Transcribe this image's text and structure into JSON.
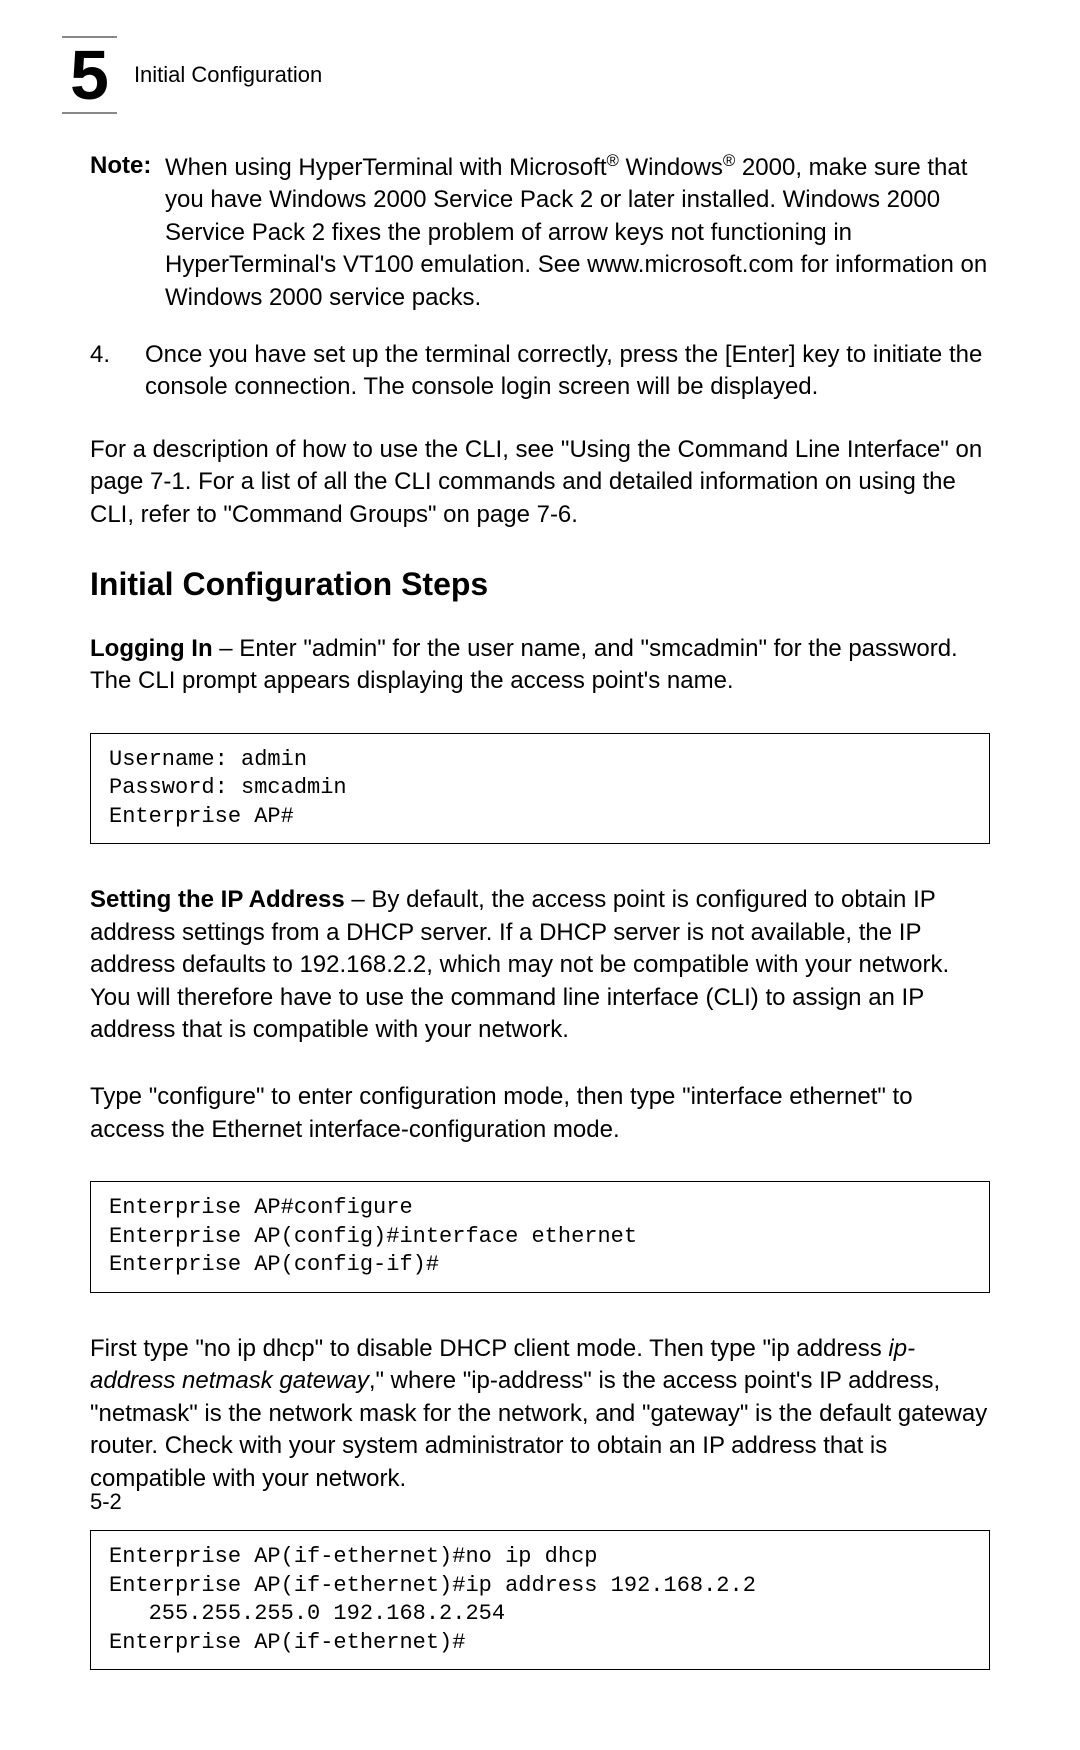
{
  "header": {
    "chapter_number": "5",
    "title": "Initial Configuration"
  },
  "note": {
    "label": "Note:",
    "text_before_reg1": "When using HyperTerminal with Microsoft",
    "reg1": "®",
    "text_mid": " Windows",
    "reg2": "®",
    "text_after": " 2000, make sure that you have Windows 2000 Service Pack 2 or later installed. Windows 2000 Service Pack 2 fixes the problem of arrow keys not functioning in HyperTerminal's VT100 emulation. See www.microsoft.com for information on Windows 2000 service packs."
  },
  "step4": {
    "num": "4.",
    "text": "Once you have set up the terminal correctly, press the [Enter] key to initiate the console connection. The console login screen will be displayed."
  },
  "cli_ref": "For a description of how to use the CLI, see \"Using the Command Line Interface\" on page 7-1. For a list of all the CLI commands and detailed information on using the CLI, refer to \"Command Groups\" on page 7-6.",
  "section_title": "Initial Configuration Steps",
  "logging_in": {
    "lead": "Logging In",
    "text": " – Enter \"admin\" for the user name, and \"smcadmin\" for the password. The CLI prompt appears displaying the access point's name."
  },
  "code1": "Username: admin\nPassword: smcadmin\nEnterprise AP#",
  "setting_ip": {
    "lead": "Setting the IP Address",
    "text": " – By default, the access point is configured to obtain IP address settings from a DHCP server. If a DHCP server is not available, the IP address defaults to 192.168.2.2, which may not be compatible with your network. You will therefore have to use the command line interface (CLI) to assign an IP address that is compatible with your network."
  },
  "type_configure": "Type \"configure\" to enter configuration mode, then type \"interface ethernet\" to access the Ethernet interface-configuration mode.",
  "code2": "Enterprise AP#configure\nEnterprise AP(config)#interface ethernet\nEnterprise AP(config-if)#",
  "first_type": {
    "part1": "First type \"no ip dhcp\" to disable DHCP client mode. Then type \"ip address ",
    "italic": "ip-address netmask gateway",
    "part2": ",\" where \"ip-address\" is the access point's IP address, \"netmask\" is the network mask for the network, and \"gateway\" is the default gateway router. Check with your system administrator to obtain an IP address that is compatible with your network."
  },
  "code3": "Enterprise AP(if-ethernet)#no ip dhcp\nEnterprise AP(if-ethernet)#ip address 192.168.2.2\n   255.255.255.0 192.168.2.254\nEnterprise AP(if-ethernet)#",
  "page_number": "5-2"
}
